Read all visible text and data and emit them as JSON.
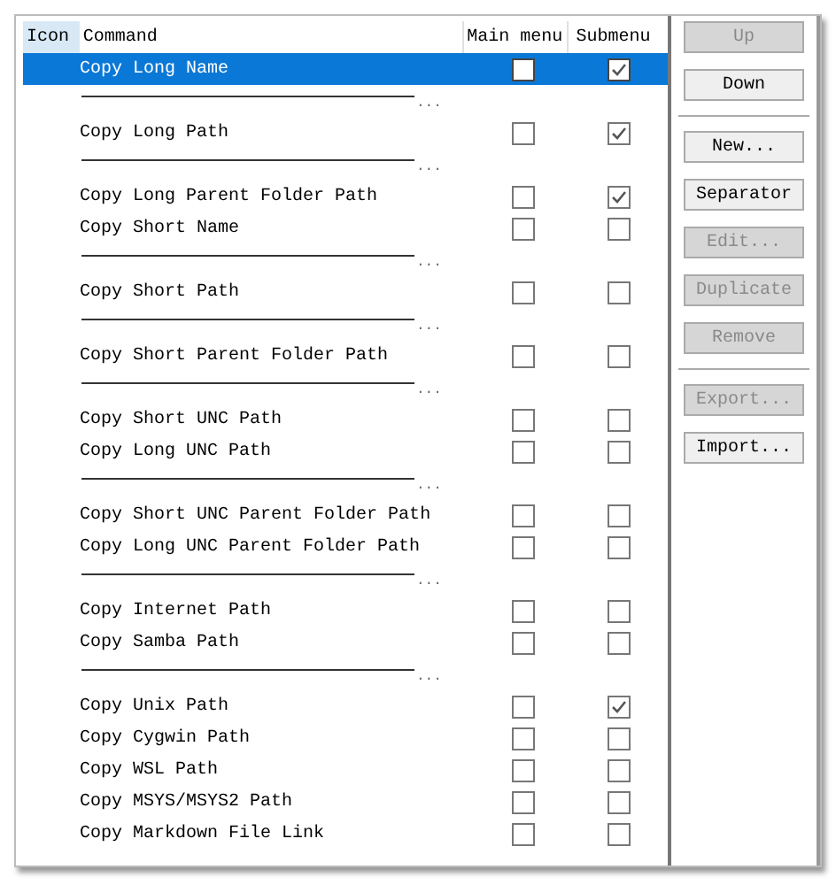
{
  "list": {
    "columns": [
      "Icon",
      "Command",
      "Main menu",
      "Submenu"
    ],
    "rows": [
      {
        "kind": "command",
        "label": "Copy Long Name",
        "main_menu": false,
        "submenu": true,
        "selected": true
      },
      {
        "kind": "separator",
        "label": "..."
      },
      {
        "kind": "command",
        "label": "Copy Long Path",
        "main_menu": false,
        "submenu": true,
        "selected": false
      },
      {
        "kind": "separator",
        "label": "..."
      },
      {
        "kind": "command",
        "label": "Copy Long Parent Folder Path",
        "main_menu": false,
        "submenu": true,
        "selected": false
      },
      {
        "kind": "command",
        "label": "Copy Short Name",
        "main_menu": false,
        "submenu": false,
        "selected": false
      },
      {
        "kind": "separator",
        "label": "..."
      },
      {
        "kind": "command",
        "label": "Copy Short Path",
        "main_menu": false,
        "submenu": false,
        "selected": false
      },
      {
        "kind": "separator",
        "label": "..."
      },
      {
        "kind": "command",
        "label": "Copy Short Parent Folder Path",
        "main_menu": false,
        "submenu": false,
        "selected": false
      },
      {
        "kind": "separator",
        "label": "..."
      },
      {
        "kind": "command",
        "label": "Copy Short UNC Path",
        "main_menu": false,
        "submenu": false,
        "selected": false
      },
      {
        "kind": "command",
        "label": "Copy Long UNC Path",
        "main_menu": false,
        "submenu": false,
        "selected": false
      },
      {
        "kind": "separator",
        "label": "..."
      },
      {
        "kind": "command",
        "label": "Copy Short UNC Parent Folder Path",
        "main_menu": false,
        "submenu": false,
        "selected": false
      },
      {
        "kind": "command",
        "label": "Copy Long UNC Parent Folder Path",
        "main_menu": false,
        "submenu": false,
        "selected": false
      },
      {
        "kind": "separator",
        "label": "..."
      },
      {
        "kind": "command",
        "label": "Copy Internet Path",
        "main_menu": false,
        "submenu": false,
        "selected": false
      },
      {
        "kind": "command",
        "label": "Copy Samba Path",
        "main_menu": false,
        "submenu": false,
        "selected": false
      },
      {
        "kind": "separator",
        "label": "..."
      },
      {
        "kind": "command",
        "label": "Copy Unix Path",
        "main_menu": false,
        "submenu": true,
        "selected": false
      },
      {
        "kind": "command",
        "label": "Copy Cygwin Path",
        "main_menu": false,
        "submenu": false,
        "selected": false
      },
      {
        "kind": "command",
        "label": "Copy WSL Path",
        "main_menu": false,
        "submenu": false,
        "selected": false
      },
      {
        "kind": "command",
        "label": "Copy MSYS/MSYS2 Path",
        "main_menu": false,
        "submenu": false,
        "selected": false
      },
      {
        "kind": "command",
        "label": "Copy Markdown File Link",
        "main_menu": false,
        "submenu": false,
        "selected": false
      }
    ]
  },
  "buttons": [
    {
      "label": "Up",
      "disabled": true
    },
    {
      "label": "Down",
      "disabled": false
    },
    {
      "kind": "divider"
    },
    {
      "label": "New...",
      "disabled": false
    },
    {
      "label": "Separator",
      "disabled": false
    },
    {
      "label": "Edit...",
      "disabled": true
    },
    {
      "label": "Duplicate",
      "disabled": true
    },
    {
      "label": "Remove",
      "disabled": true
    },
    {
      "kind": "divider"
    },
    {
      "label": "Export...",
      "disabled": true
    },
    {
      "label": "Import...",
      "disabled": false
    }
  ]
}
